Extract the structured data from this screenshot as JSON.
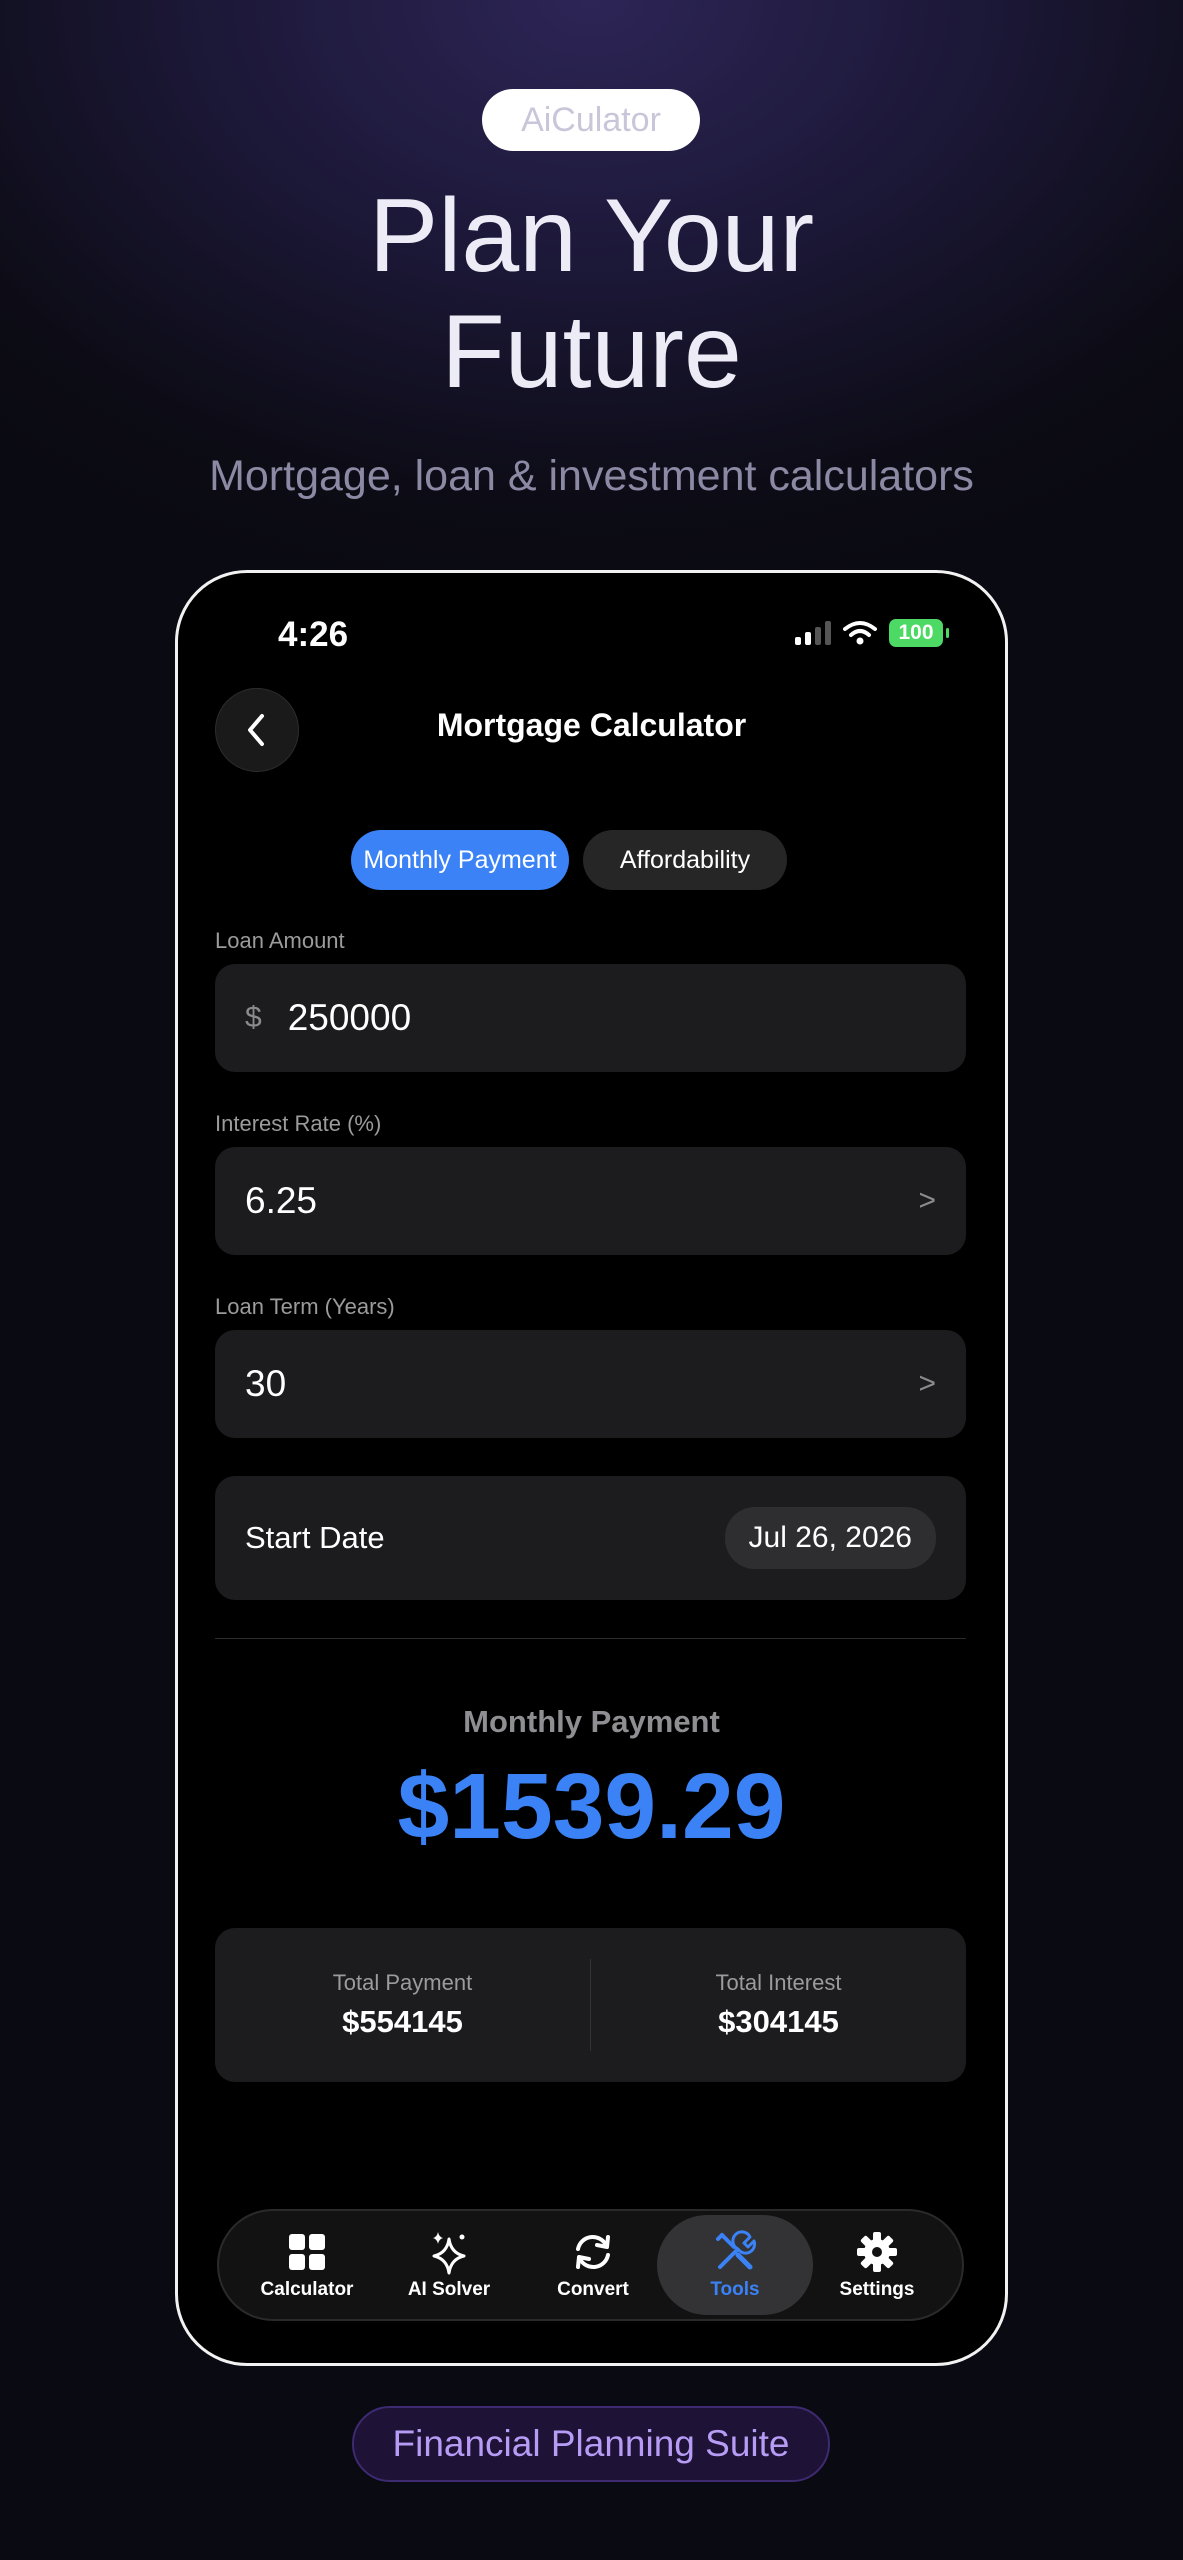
{
  "brand_badge": "AiCulator",
  "headline": {
    "line1": "Plan Your",
    "line2": "Future"
  },
  "subheadline": "Mortgage, loan & investment calculators",
  "status_bar": {
    "time": "4:26",
    "battery": "100"
  },
  "nav": {
    "title": "Mortgage Calculator",
    "back_icon": "chevron-left-icon"
  },
  "segments": [
    {
      "label": "Monthly Payment",
      "active": true
    },
    {
      "label": "Affordability",
      "active": false
    }
  ],
  "form": {
    "loan_amount": {
      "label": "Loan Amount",
      "currency": "$",
      "value": "250000"
    },
    "interest_rate": {
      "label": "Interest Rate (%)",
      "value": "6.25",
      "chevron": ">"
    },
    "loan_term": {
      "label": "Loan Term (Years)",
      "value": "30",
      "chevron": ">"
    },
    "start_date": {
      "label": "Start Date",
      "value": "Jul 26, 2026"
    }
  },
  "result": {
    "label": "Monthly Payment",
    "value": "$1539.29",
    "total_payment": {
      "label": "Total Payment",
      "value": "$554145"
    },
    "total_interest": {
      "label": "Total Interest",
      "value": "$304145"
    }
  },
  "tabbar": [
    {
      "label": "Calculator",
      "icon": "grid-icon",
      "active": false
    },
    {
      "label": "AI Solver",
      "icon": "sparkles-icon",
      "active": false
    },
    {
      "label": "Convert",
      "icon": "refresh-icon",
      "active": false
    },
    {
      "label": "Tools",
      "icon": "tools-icon",
      "active": true
    },
    {
      "label": "Settings",
      "icon": "gear-icon",
      "active": false
    }
  ],
  "footer_badge": "Financial Planning Suite",
  "colors": {
    "accent": "#3a82f6",
    "background": "#0d0c16",
    "card": "#1c1c1e",
    "footer_accent": "#b69cf5"
  }
}
